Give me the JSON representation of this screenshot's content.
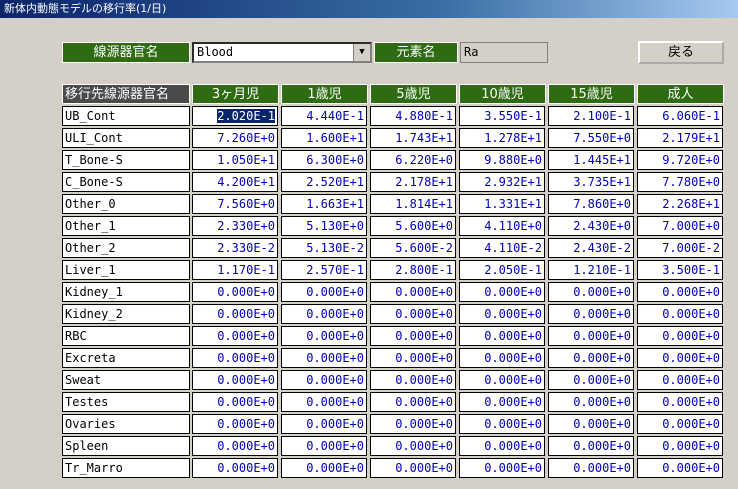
{
  "window": {
    "title": "新体内動態モデルの移行率(1/日)"
  },
  "source": {
    "label": "線源器官名",
    "value": "Blood"
  },
  "element": {
    "label": "元素名",
    "value": "Ra"
  },
  "back_button": {
    "label": "戻る"
  },
  "table": {
    "headers": [
      "移行先線源器官名",
      "3ヶ月児",
      "1歳児",
      "5歳児",
      "10歳児",
      "15歳児",
      "成人"
    ],
    "rows": [
      {
        "name": "UB_Cont",
        "values": [
          "2.020E-1",
          "4.440E-1",
          "4.880E-1",
          "3.550E-1",
          "2.100E-1",
          "6.060E-1"
        ]
      },
      {
        "name": "ULI_Cont",
        "values": [
          "7.260E+0",
          "1.600E+1",
          "1.743E+1",
          "1.278E+1",
          "7.550E+0",
          "2.179E+1"
        ]
      },
      {
        "name": "T_Bone-S",
        "values": [
          "1.050E+1",
          "6.300E+0",
          "6.220E+0",
          "9.880E+0",
          "1.445E+1",
          "9.720E+0"
        ]
      },
      {
        "name": "C_Bone-S",
        "values": [
          "4.200E+1",
          "2.520E+1",
          "2.178E+1",
          "2.932E+1",
          "3.735E+1",
          "7.780E+0"
        ]
      },
      {
        "name": "Other_0",
        "values": [
          "7.560E+0",
          "1.663E+1",
          "1.814E+1",
          "1.331E+1",
          "7.860E+0",
          "2.268E+1"
        ]
      },
      {
        "name": "Other_1",
        "values": [
          "2.330E+0",
          "5.130E+0",
          "5.600E+0",
          "4.110E+0",
          "2.430E+0",
          "7.000E+0"
        ]
      },
      {
        "name": "Other_2",
        "values": [
          "2.330E-2",
          "5.130E-2",
          "5.600E-2",
          "4.110E-2",
          "2.430E-2",
          "7.000E-2"
        ]
      },
      {
        "name": "Liver_1",
        "values": [
          "1.170E-1",
          "2.570E-1",
          "2.800E-1",
          "2.050E-1",
          "1.210E-1",
          "3.500E-1"
        ]
      },
      {
        "name": "Kidney_1",
        "values": [
          "0.000E+0",
          "0.000E+0",
          "0.000E+0",
          "0.000E+0",
          "0.000E+0",
          "0.000E+0"
        ]
      },
      {
        "name": "Kidney_2",
        "values": [
          "0.000E+0",
          "0.000E+0",
          "0.000E+0",
          "0.000E+0",
          "0.000E+0",
          "0.000E+0"
        ]
      },
      {
        "name": "RBC",
        "values": [
          "0.000E+0",
          "0.000E+0",
          "0.000E+0",
          "0.000E+0",
          "0.000E+0",
          "0.000E+0"
        ]
      },
      {
        "name": "Excreta",
        "values": [
          "0.000E+0",
          "0.000E+0",
          "0.000E+0",
          "0.000E+0",
          "0.000E+0",
          "0.000E+0"
        ]
      },
      {
        "name": "Sweat",
        "values": [
          "0.000E+0",
          "0.000E+0",
          "0.000E+0",
          "0.000E+0",
          "0.000E+0",
          "0.000E+0"
        ]
      },
      {
        "name": "Testes",
        "values": [
          "0.000E+0",
          "0.000E+0",
          "0.000E+0",
          "0.000E+0",
          "0.000E+0",
          "0.000E+0"
        ]
      },
      {
        "name": "Ovaries",
        "values": [
          "0.000E+0",
          "0.000E+0",
          "0.000E+0",
          "0.000E+0",
          "0.000E+0",
          "0.000E+0"
        ]
      },
      {
        "name": "Spleen",
        "values": [
          "0.000E+0",
          "0.000E+0",
          "0.000E+0",
          "0.000E+0",
          "0.000E+0",
          "0.000E+0"
        ]
      },
      {
        "name": "Tr_Marro",
        "values": [
          "0.000E+0",
          "0.000E+0",
          "0.000E+0",
          "0.000E+0",
          "0.000E+0",
          "0.000E+0"
        ]
      }
    ]
  },
  "colors": {
    "header_green": "#2e6b12",
    "value_blue": "#0000b0",
    "selection": "#0a246a"
  }
}
